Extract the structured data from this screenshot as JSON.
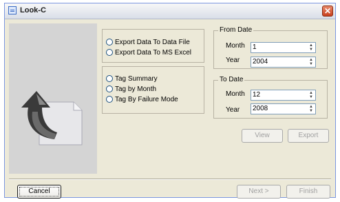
{
  "window": {
    "title": "Look-C",
    "close_glyph": "✕"
  },
  "export_options": [
    {
      "label": "Export Data To Data File"
    },
    {
      "label": "Export Data To MS Excel"
    }
  ],
  "tag_options": [
    {
      "label": "Tag Summary"
    },
    {
      "label": "Tag by Month"
    },
    {
      "label": "Tag By Failure Mode"
    }
  ],
  "from_date": {
    "legend": "From Date",
    "month_label": "Month",
    "month_value": "1",
    "year_label": "Year",
    "year_value": "2004"
  },
  "to_date": {
    "legend": "To Date",
    "month_label": "Month",
    "month_value": "12",
    "year_label": "Year",
    "year_value": "2008"
  },
  "buttons": {
    "view": "View",
    "export": "Export",
    "cancel": "Cancel",
    "next": "Next >",
    "finish": "Finish"
  },
  "icons": {
    "app": "grid-app-icon",
    "illustration": "export-document-arrow-icon",
    "spin_up": "▲",
    "spin_down": "▼"
  }
}
